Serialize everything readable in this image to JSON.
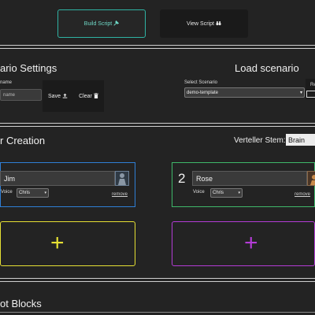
{
  "toolbar": {
    "build_label": "Build Script",
    "build_icon": "hammer-icon",
    "view_label": "View Script",
    "view_icon": "binoculars-icon"
  },
  "scenario_settings": {
    "title": "ario Settings",
    "name_label": "name",
    "name_placeholder": "name",
    "save_label": "Save",
    "clear_label": "Clear"
  },
  "load_scenario": {
    "title": "Load scenario",
    "select_label": "Select Scenario",
    "selected": "demo-template",
    "right_label": "Re"
  },
  "character_creation": {
    "title": "r Creation",
    "verteller_label": "Verteller Stem:",
    "verteller_value": "Brain",
    "characters": [
      {
        "number": "",
        "name": "Jim",
        "voice_label": "Voice",
        "voice": "Chris",
        "remove_label": "remove",
        "color": "#2f7fd6"
      },
      {
        "number": "2",
        "name": "Rose",
        "voice_label": "Voice",
        "voice": "Chris",
        "remove_label": "remove",
        "color": "#3fb86a"
      }
    ],
    "add_buttons": [
      {
        "symbol": "+",
        "color": "#e6e034"
      },
      {
        "symbol": "+",
        "color": "#b43cd6"
      }
    ]
  },
  "blocks": {
    "title": "ot Blocks"
  },
  "colors": {
    "background": "#232323",
    "build_border": "#2fb3a4",
    "build_text": "#6fd8c6",
    "rule": "#cfcfcf"
  }
}
